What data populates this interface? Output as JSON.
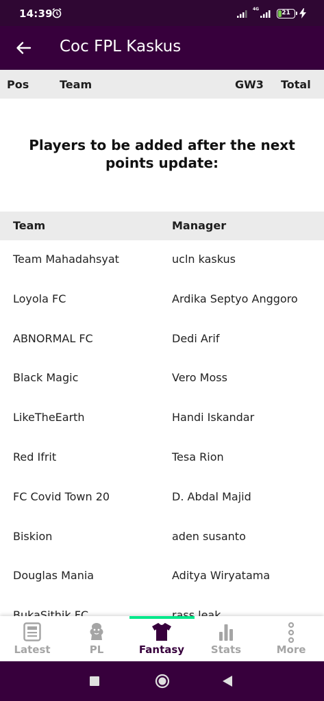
{
  "status_bar": {
    "time": "14:39",
    "network_label": "4G",
    "battery_level": "21",
    "battery_percent": 21,
    "icons": [
      "alarm-icon",
      "signal-icon",
      "signal-4g-icon",
      "battery-icon",
      "charging-bolt-icon"
    ]
  },
  "app_bar": {
    "title": "Coc FPL Kaskus",
    "back_icon": "arrow-left-icon"
  },
  "standings_header": {
    "pos": "Pos",
    "team": "Team",
    "gw": "GW3",
    "total": "Total"
  },
  "notice": "Players to be added after the next points update:",
  "pending_table": {
    "headers": {
      "team": "Team",
      "manager": "Manager"
    },
    "rows": [
      {
        "team": "Team Mahadahsyat",
        "manager": "ucln kaskus"
      },
      {
        "team": "Loyola FC",
        "manager": "Ardika Septyo Anggoro"
      },
      {
        "team": "ABNORMAL FC",
        "manager": "Dedi Arif"
      },
      {
        "team": "Black Magic",
        "manager": "Vero Moss"
      },
      {
        "team": "LikeTheEarth",
        "manager": "Handi Iskandar"
      },
      {
        "team": "Red Ifrit",
        "manager": "Tesa Rion"
      },
      {
        "team": "FC Covid Town 20",
        "manager": "D. Abdal Majid"
      },
      {
        "team": "Biskion",
        "manager": "aden susanto"
      },
      {
        "team": "Douglas Mania",
        "manager": "Aditya Wiryatama"
      },
      {
        "team": "BukaSithik FC",
        "manager": "rass leak"
      }
    ]
  },
  "bottom_nav": {
    "items": [
      {
        "label": "Latest",
        "icon": "news-icon",
        "active": false
      },
      {
        "label": "PL",
        "icon": "premier-league-lion-icon",
        "active": false
      },
      {
        "label": "Fantasy",
        "icon": "jersey-icon",
        "active": true
      },
      {
        "label": "Stats",
        "icon": "bar-chart-icon",
        "active": false
      },
      {
        "label": "More",
        "icon": "more-vertical-icon",
        "active": false
      }
    ]
  },
  "colors": {
    "brand_purple": "#37003c",
    "accent_green": "#00e88a",
    "header_grey": "#ebebeb",
    "inactive_grey": "#a5a5a5"
  }
}
